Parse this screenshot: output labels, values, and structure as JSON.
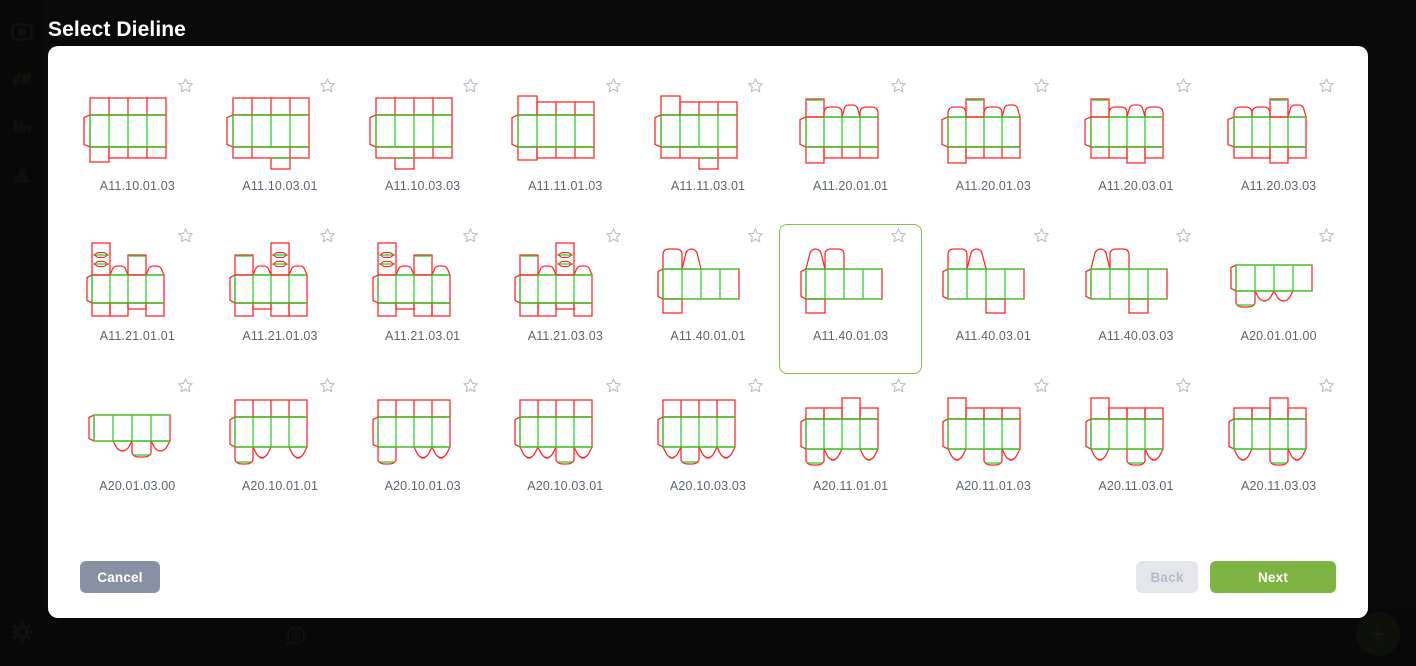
{
  "app": {
    "background_color": "#121212",
    "sidebar": {
      "items": [
        {
          "icon": "box-outline-icon",
          "name": "sidebar-item-project"
        },
        {
          "icon": "shape-3d-icon",
          "name": "sidebar-item-shapes"
        },
        {
          "icon": "video-camera-icon",
          "name": "sidebar-item-render"
        },
        {
          "icon": "upload-icon",
          "name": "sidebar-item-upload"
        }
      ],
      "bottom_item": {
        "icon": "gear-icon",
        "name": "sidebar-item-settings"
      }
    },
    "bottom_bar": {
      "left_icon": "zoom-3d-box-icon",
      "fab": {
        "icon": "plus-icon",
        "label": "+",
        "color": "#7cb342"
      }
    }
  },
  "modal": {
    "title": "Select Dieline",
    "accent_color": "#7cb342",
    "selected_id": "A11.40.01.03",
    "footer": {
      "cancel_label": "Cancel",
      "back_label": "Back",
      "back_disabled": true,
      "next_label": "Next"
    },
    "columns": 9,
    "items": [
      {
        "id": "A11.10.01.03",
        "shape": "t1",
        "starred": false
      },
      {
        "id": "A11.10.03.01",
        "shape": "t2",
        "starred": false
      },
      {
        "id": "A11.10.03.03",
        "shape": "t3",
        "starred": false
      },
      {
        "id": "A11.11.01.03",
        "shape": "t4",
        "starred": false
      },
      {
        "id": "A11.11.03.01",
        "shape": "t5",
        "starred": false
      },
      {
        "id": "A11.20.01.01",
        "shape": "t6",
        "starred": false
      },
      {
        "id": "A11.20.01.03",
        "shape": "t7",
        "starred": false
      },
      {
        "id": "A11.20.03.01",
        "shape": "t8",
        "starred": false
      },
      {
        "id": "A11.20.03.03",
        "shape": "t9",
        "starred": false
      },
      {
        "id": "A11.21.01.01",
        "shape": "t10",
        "starred": false
      },
      {
        "id": "A11.21.01.03",
        "shape": "t11",
        "starred": false
      },
      {
        "id": "A11.21.03.01",
        "shape": "t12",
        "starred": false
      },
      {
        "id": "A11.21.03.03",
        "shape": "t13",
        "starred": false
      },
      {
        "id": "A11.40.01.01",
        "shape": "t14",
        "starred": false
      },
      {
        "id": "A11.40.01.03",
        "shape": "t15",
        "starred": false
      },
      {
        "id": "A11.40.03.01",
        "shape": "t16",
        "starred": false
      },
      {
        "id": "A11.40.03.03",
        "shape": "t17",
        "starred": false
      },
      {
        "id": "A20.01.01.00",
        "shape": "t18",
        "starred": false
      },
      {
        "id": "A20.01.03.00",
        "shape": "t19",
        "starred": false
      },
      {
        "id": "A20.10.01.01",
        "shape": "t20",
        "starred": false
      },
      {
        "id": "A20.10.01.03",
        "shape": "t21",
        "starred": false
      },
      {
        "id": "A20.10.03.01",
        "shape": "t22",
        "starred": false
      },
      {
        "id": "A20.10.03.03",
        "shape": "t23",
        "starred": false
      },
      {
        "id": "A20.11.01.01",
        "shape": "t24",
        "starred": false
      },
      {
        "id": "A20.11.01.03",
        "shape": "t25",
        "starred": false
      },
      {
        "id": "A20.11.03.01",
        "shape": "t26",
        "starred": false
      },
      {
        "id": "A20.11.03.03",
        "shape": "t27",
        "starred": false
      }
    ],
    "dieline_colors": {
      "cut": "#ff2a2a",
      "fold": "#2ad42a"
    }
  }
}
